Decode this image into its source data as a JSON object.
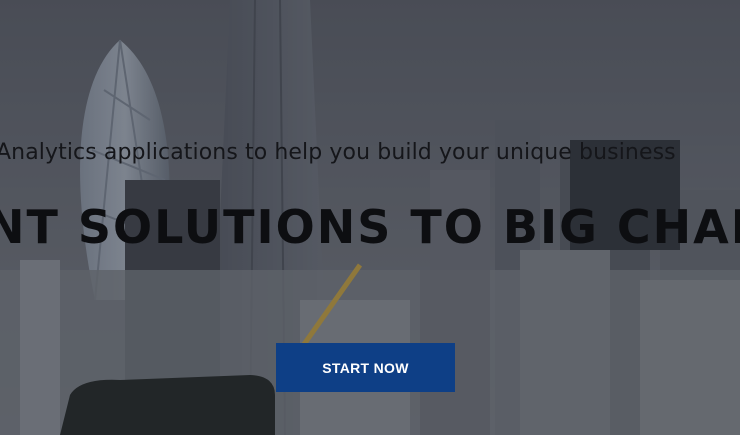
{
  "hero": {
    "subtitle": "Analytics applications to help you build your unique business",
    "headline": "NT SOLUTIONS TO BIG CHALL",
    "cta_label": "START NOW"
  },
  "colors": {
    "cta_background": "#0e3f86",
    "cta_text": "#ffffff",
    "headline_text": "#0d0e11"
  }
}
